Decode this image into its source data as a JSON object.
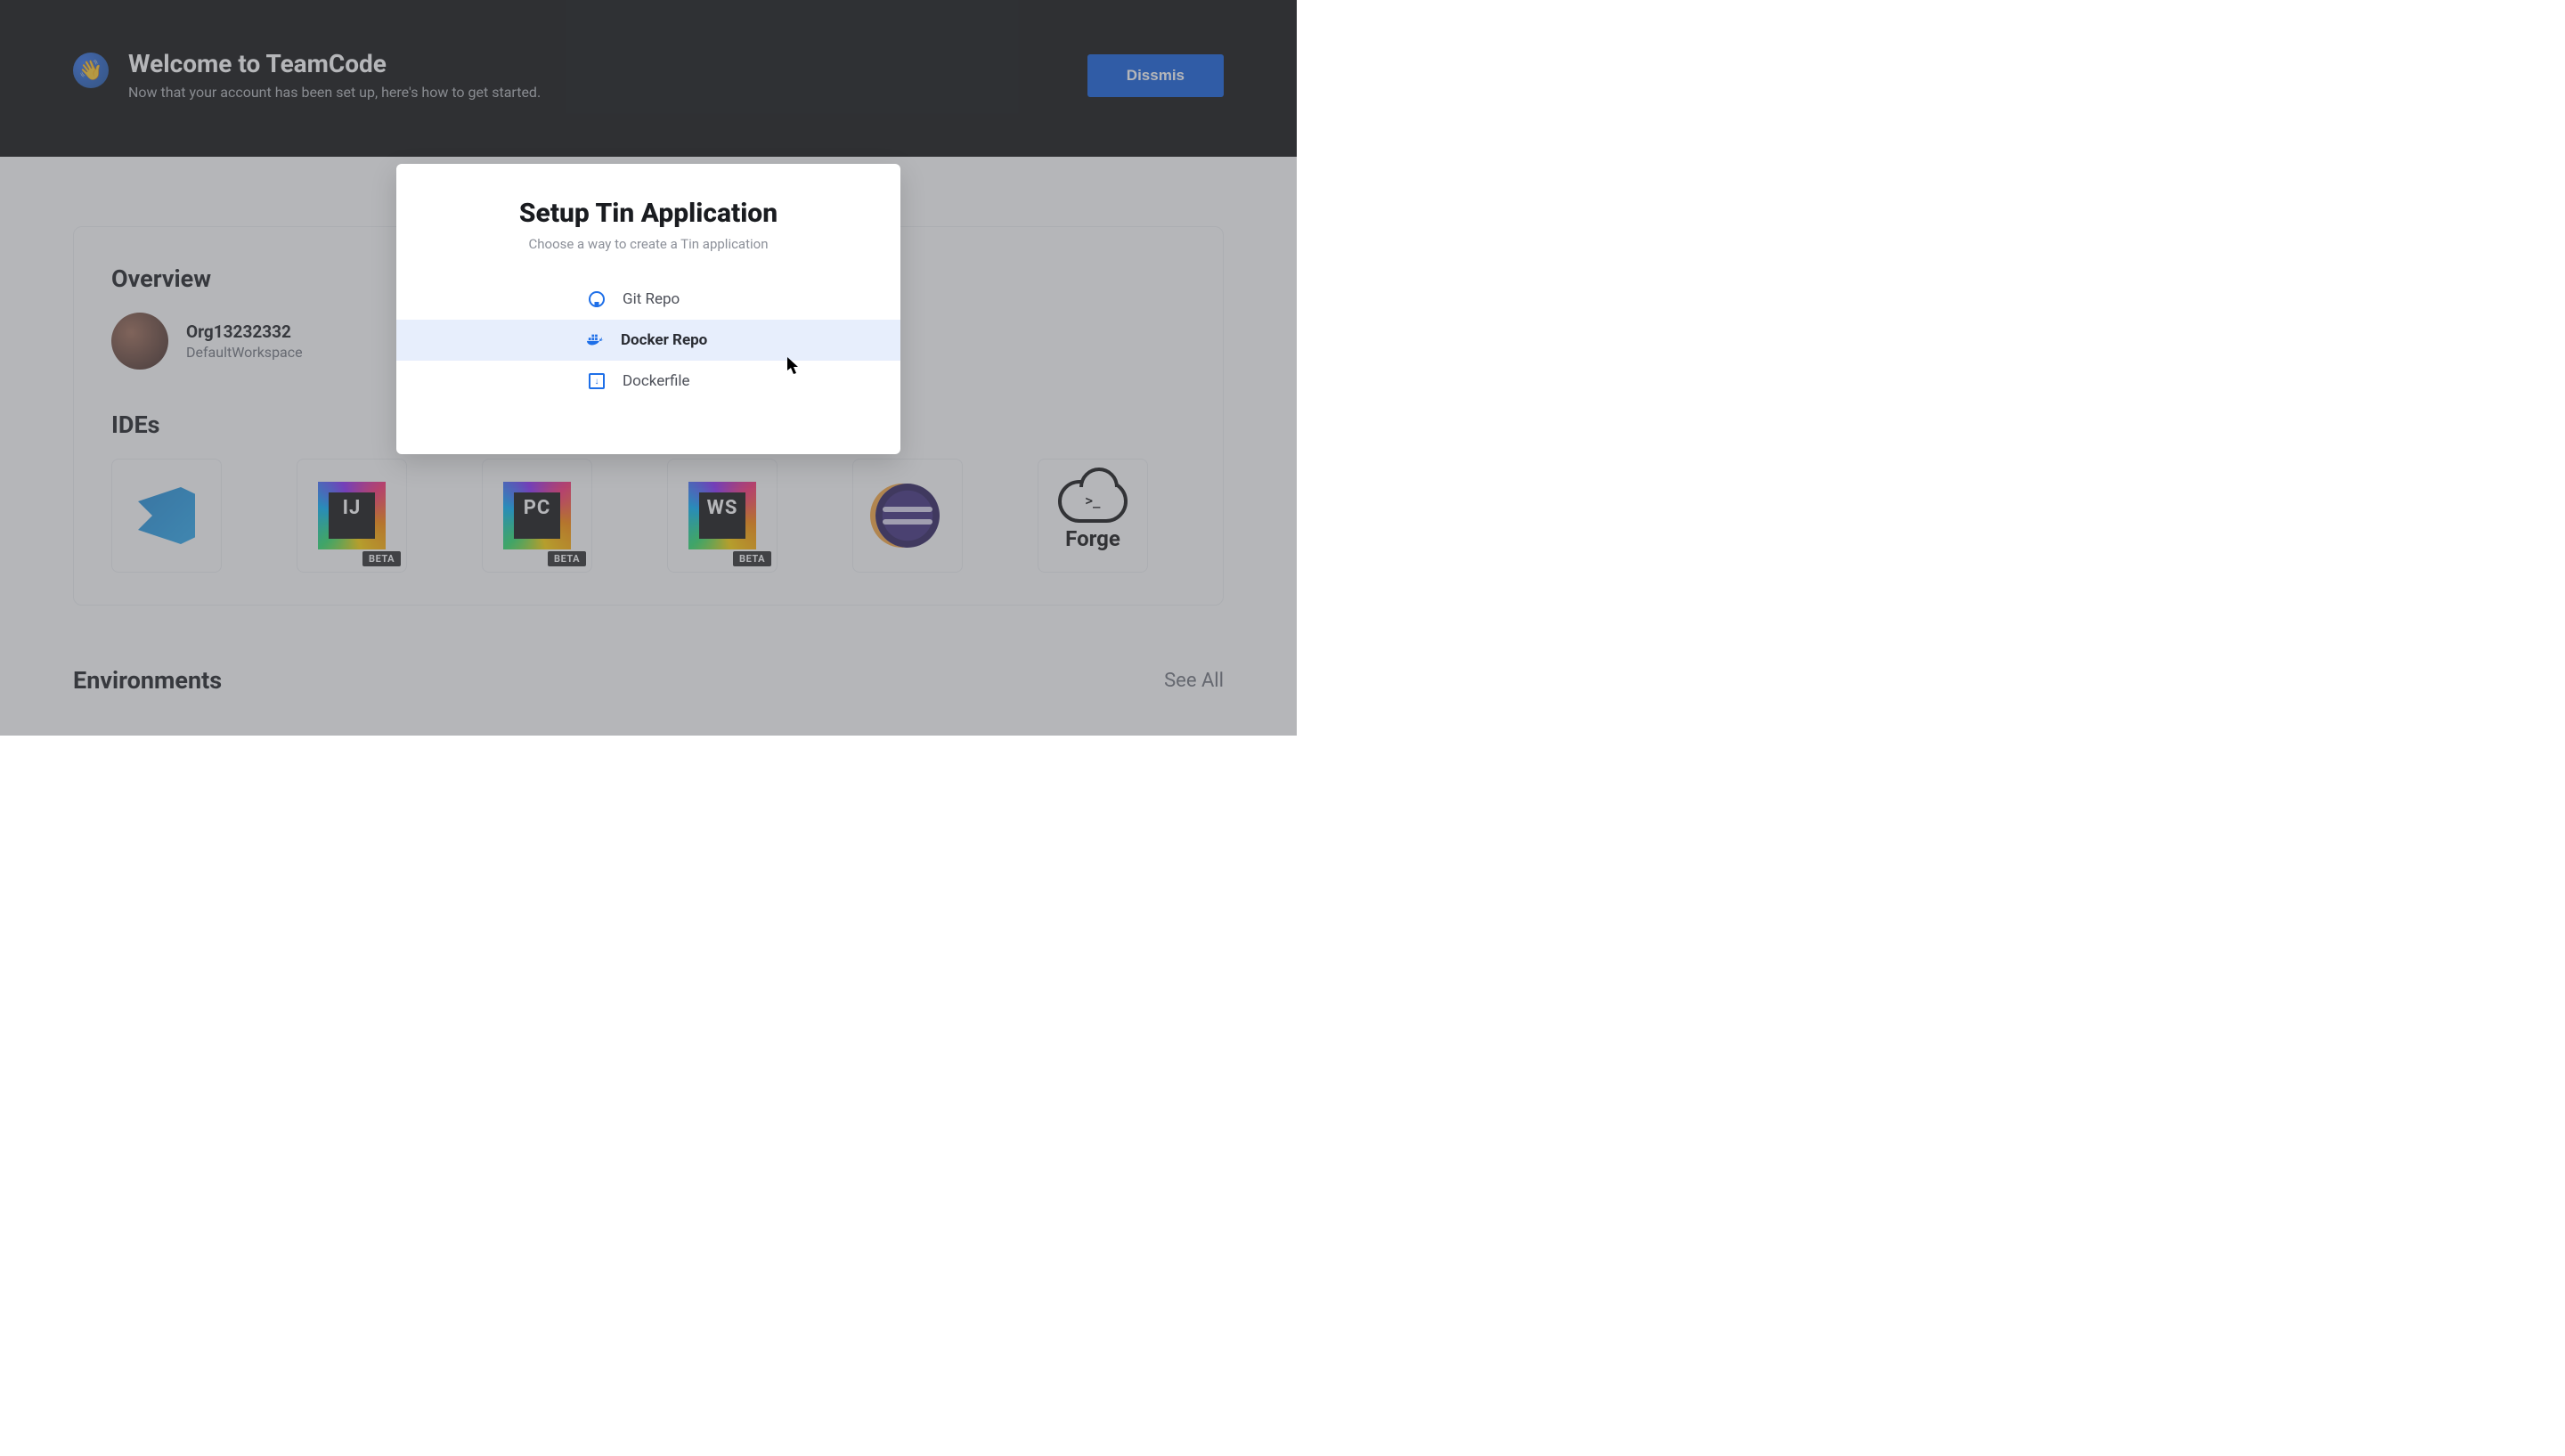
{
  "banner": {
    "title": "Welcome to TeamCode",
    "subtitle": "Now that your account has been set up, here's how to get started.",
    "dismiss_label": "Dissmis"
  },
  "overview": {
    "section_title": "Overview",
    "org_name": "Org13232332",
    "workspace_name": "DefaultWorkspace"
  },
  "ides": {
    "section_title": "IDEs",
    "tiles": [
      {
        "name": "VSCode",
        "badge": ""
      },
      {
        "name": "IJ",
        "badge": "BETA"
      },
      {
        "name": "PC",
        "badge": "BETA"
      },
      {
        "name": "WS",
        "badge": "BETA"
      },
      {
        "name": "Eclipse",
        "badge": ""
      },
      {
        "name": "Forge",
        "badge": ""
      }
    ],
    "beta_label": "BETA",
    "forge_label": "Forge"
  },
  "environments": {
    "section_title": "Environments",
    "see_all_label": "See All"
  },
  "modal": {
    "title": "Setup Tin Application",
    "subtitle": "Choose a way to create a Tin application",
    "options": [
      {
        "label": "Git Repo",
        "selected": false
      },
      {
        "label": "Docker Repo",
        "selected": true
      },
      {
        "label": "Dockerfile",
        "selected": false
      }
    ]
  }
}
